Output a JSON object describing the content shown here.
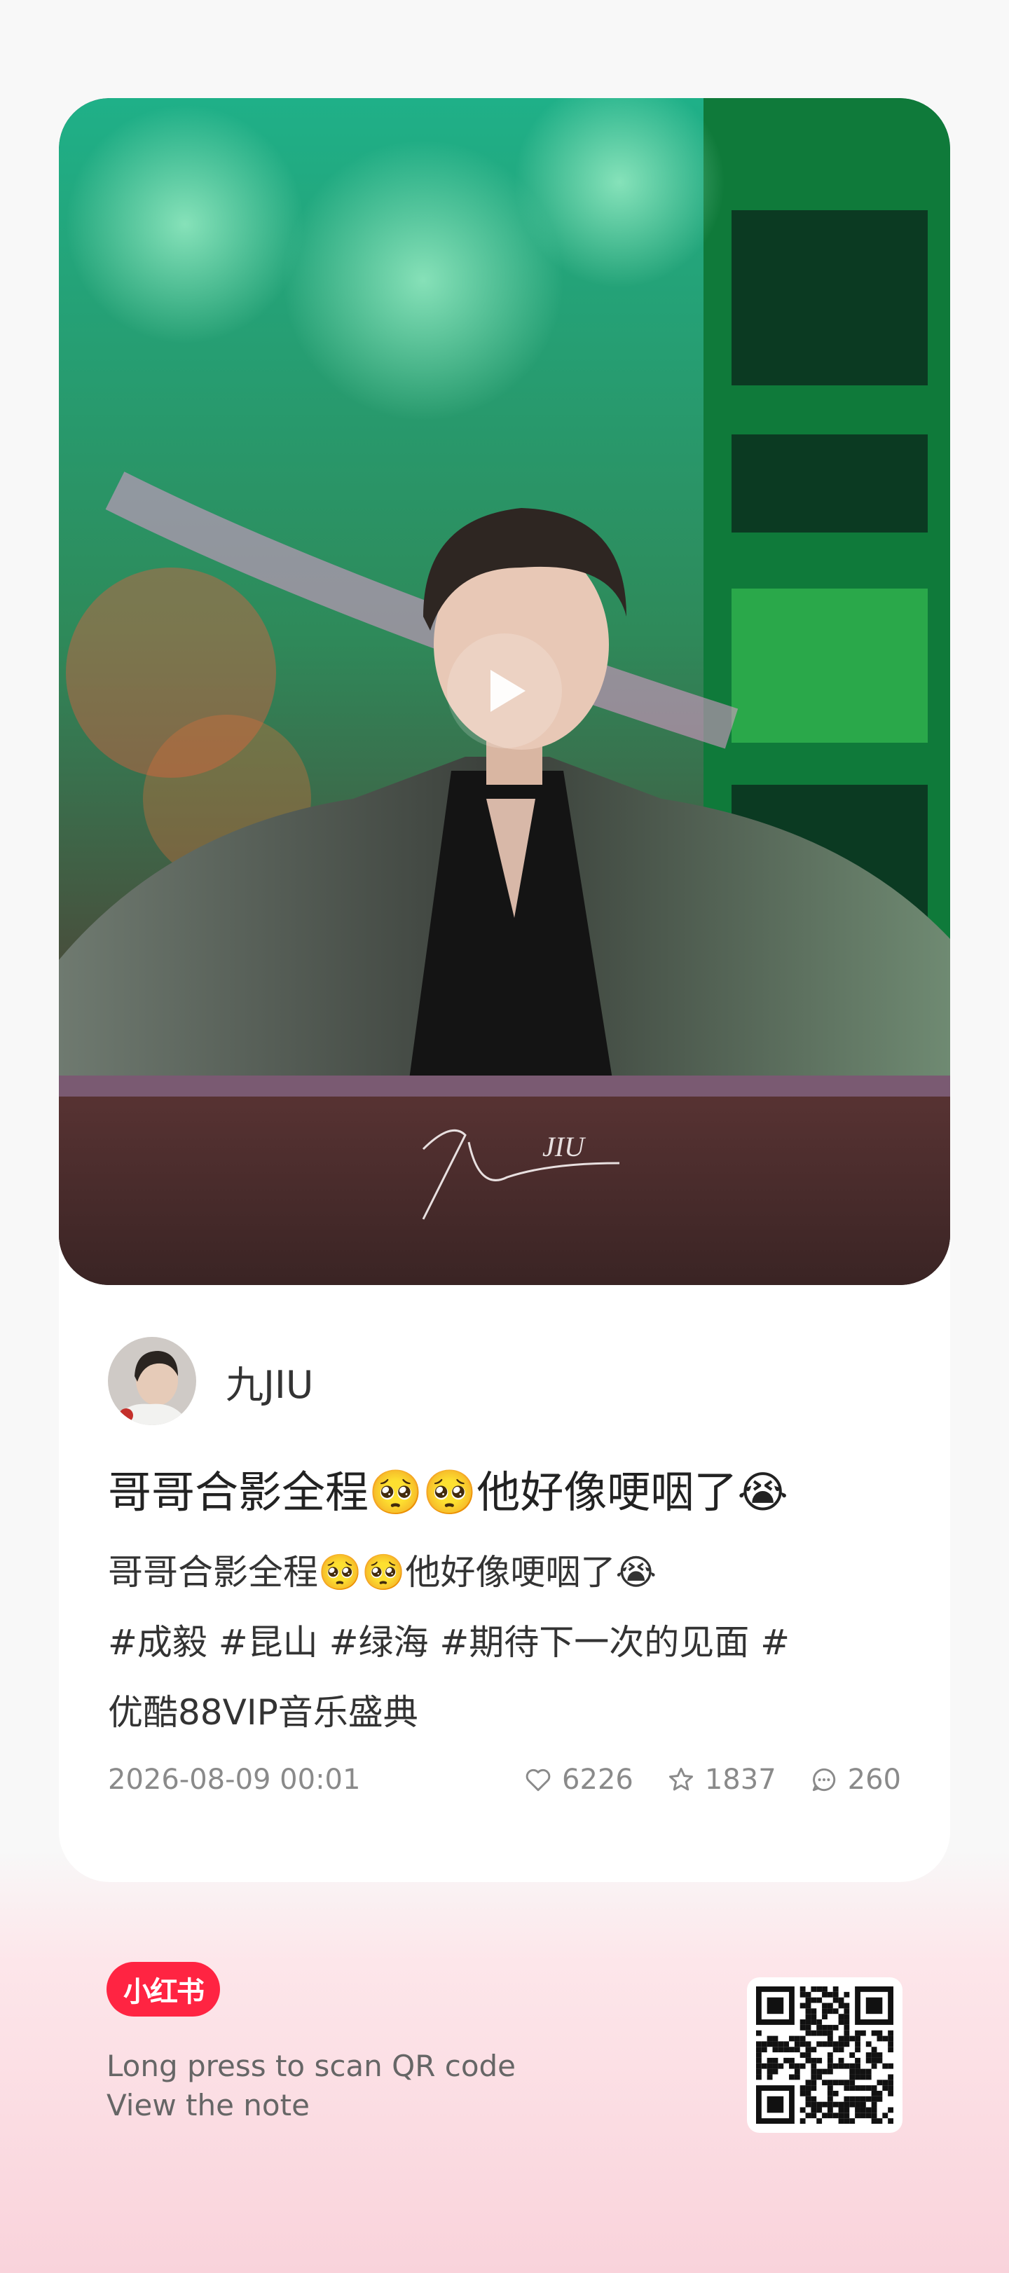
{
  "media": {
    "signature_text": "JIU",
    "play_icon": "play-icon"
  },
  "author": {
    "name": "九JIU",
    "avatar_icon": "avatar"
  },
  "note": {
    "title": "哥哥合影全程🥺🥺他好像哽咽了😭",
    "body_line1": "哥哥合影全程🥺🥺他好像哽咽了😭",
    "body_line2": "#成毅 #昆山 #绿海 #期待下一次的见面 #",
    "body_line3": "优酷88VIP音乐盛典"
  },
  "meta": {
    "date": "2026-08-09 00:01",
    "likes": "6226",
    "collects": "1837",
    "comments": "260",
    "like_icon": "heart-icon",
    "collect_icon": "star-icon",
    "comment_icon": "comment-icon"
  },
  "footer": {
    "logo_text": "小红书",
    "line1": "Long press to scan QR code",
    "line2": "View the note",
    "qr_icon": "qr-code"
  },
  "colors": {
    "brand": "#ff2442",
    "page_bg": "#f8f8f8",
    "footer_pink": "#f9d3db",
    "meta_gray": "#8a8a8a"
  }
}
